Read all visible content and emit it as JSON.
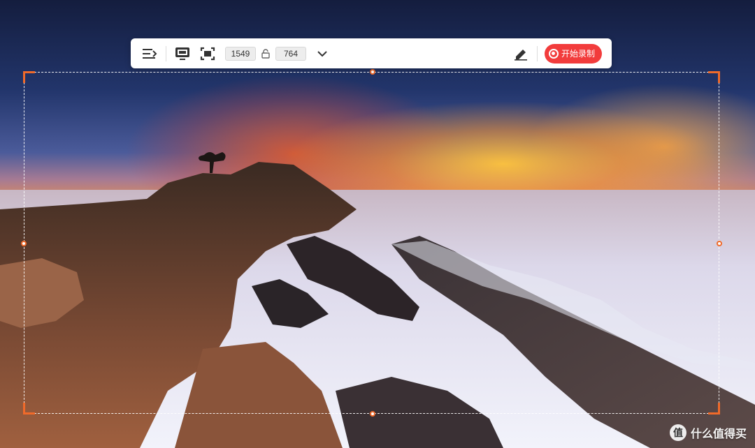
{
  "toolbar": {
    "menu_icon": "menu-collapse-icon",
    "screen_icon": "fullscreen-record-icon",
    "region_icon": "region-select-icon",
    "width_value": "1549",
    "height_value": "764",
    "lock_icon": "aspect-lock-icon",
    "dropdown_icon": "chevron-down-icon",
    "annotate_icon": "pen-annotate-icon",
    "record_label": "开始录制",
    "record_color": "#f23c3c"
  },
  "selection": {
    "border_color": "#ffffff",
    "handle_color": "#f06a2a"
  },
  "watermark": {
    "badge_text": "值",
    "text": "什么值得买"
  }
}
